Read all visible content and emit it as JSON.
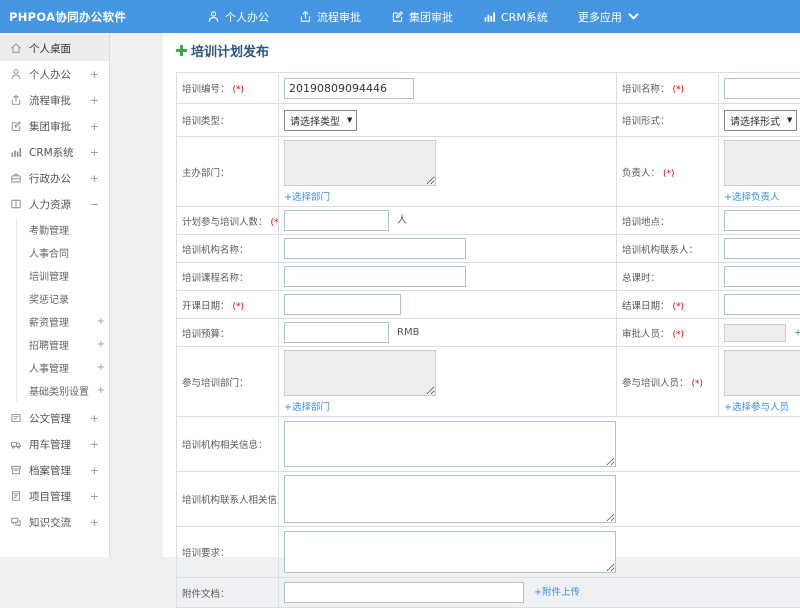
{
  "colors": {
    "topbar": "#4496e2",
    "link": "#3a8ee6",
    "required": "#e60000",
    "title": "#2a5580",
    "plus_green": "#3fa945",
    "sidebar_active": "#ececec"
  },
  "topbar": {
    "logo": "PHPOA协同办公软件",
    "menu_icon": "menu-icon",
    "nav": [
      {
        "id": "personal-office",
        "icon": "user-icon",
        "label": "个人办公"
      },
      {
        "id": "workflow-approval",
        "icon": "flow-icon",
        "label": "流程审批"
      },
      {
        "id": "group-approval",
        "icon": "edit-icon",
        "label": "集团审批"
      },
      {
        "id": "crm",
        "icon": "chart-icon",
        "label": "CRM系统"
      },
      {
        "id": "more-apps",
        "icon": "caret-down-icon",
        "label": "更多应用",
        "caret": true
      }
    ]
  },
  "sidebar": {
    "items": [
      {
        "id": "desktop",
        "icon": "home-icon",
        "label": "个人桌面",
        "active": true
      },
      {
        "id": "personal-office",
        "icon": "user-icon",
        "label": "个人办公",
        "expand": "+"
      },
      {
        "id": "workflow-approval",
        "icon": "flow-icon",
        "label": "流程审批",
        "expand": "+"
      },
      {
        "id": "group-approval",
        "icon": "edit-icon",
        "label": "集团审批",
        "expand": "+"
      },
      {
        "id": "crm",
        "icon": "chart-icon",
        "label": "CRM系统",
        "expand": "+"
      },
      {
        "id": "admin-office",
        "icon": "briefcase-icon",
        "label": "行政办公",
        "expand": "+"
      },
      {
        "id": "hr",
        "icon": "hr-icon",
        "label": "人力资源",
        "expand": "−",
        "children": [
          {
            "id": "attendance",
            "label": "考勤管理"
          },
          {
            "id": "hr-contract",
            "label": "人事合同"
          },
          {
            "id": "training-mgmt",
            "label": "培训管理"
          },
          {
            "id": "rewards",
            "label": "奖惩记录"
          },
          {
            "id": "salary",
            "label": "薪资管理",
            "expand": "+"
          },
          {
            "id": "recruit",
            "label": "招聘管理",
            "expand": "+"
          },
          {
            "id": "personnel",
            "label": "人事管理",
            "expand": "+"
          },
          {
            "id": "base-category",
            "label": "基础类别设置",
            "expand": "+"
          }
        ]
      },
      {
        "id": "official-doc",
        "icon": "doc-icon",
        "label": "公文管理",
        "expand": "+"
      },
      {
        "id": "vehicle",
        "icon": "car-icon",
        "label": "用车管理",
        "expand": "+"
      },
      {
        "id": "archive",
        "icon": "archive-icon",
        "label": "档案管理",
        "expand": "+"
      },
      {
        "id": "project",
        "icon": "project-icon",
        "label": "项目管理",
        "expand": "+"
      },
      {
        "id": "knowledge",
        "icon": "chat-icon",
        "label": "知识交流",
        "expand": "+"
      }
    ]
  },
  "main": {
    "title": "培训计划发布",
    "title_icon": "plus-icon",
    "form": {
      "rows": [
        {
          "cells": [
            {
              "id": "training-no",
              "label": "培训编号：",
              "required": true,
              "field": {
                "type": "text",
                "value": "20190809094446"
              }
            },
            {
              "id": "training-name",
              "label": "培训名称：",
              "required": true,
              "field": {
                "type": "text",
                "value": ""
              }
            }
          ]
        },
        {
          "cells": [
            {
              "id": "training-type",
              "label": "培训类型：",
              "field": {
                "type": "select",
                "value": "请选择类型"
              }
            },
            {
              "id": "training-form",
              "label": "培训形式：",
              "field": {
                "type": "select",
                "value": "请选择形式"
              }
            }
          ]
        },
        {
          "cells": [
            {
              "id": "host-dept",
              "label": "主办部门：",
              "field": {
                "type": "picker",
                "link": "+选择部门"
              }
            },
            {
              "id": "leader",
              "label": "负责人：",
              "required": true,
              "field": {
                "type": "picker",
                "link": "+选择负责人"
              }
            }
          ]
        },
        {
          "cells": [
            {
              "id": "planned-participants",
              "label": "计划参与培训人数：",
              "required": true,
              "field": {
                "type": "text",
                "value": "",
                "suffix": "人"
              }
            },
            {
              "id": "training-place",
              "label": "培训地点：",
              "field": {
                "type": "text",
                "value": ""
              }
            }
          ]
        },
        {
          "cells": [
            {
              "id": "org-name",
              "label": "培训机构名称：",
              "field": {
                "type": "text",
                "value": ""
              }
            },
            {
              "id": "org-contact",
              "label": "培训机构联系人：",
              "field": {
                "type": "text",
                "value": ""
              }
            }
          ]
        },
        {
          "cells": [
            {
              "id": "course-name",
              "label": "培训课程名称：",
              "field": {
                "type": "text",
                "value": ""
              }
            },
            {
              "id": "total-hours",
              "label": "总课时：",
              "field": {
                "type": "text",
                "value": ""
              }
            }
          ]
        },
        {
          "cells": [
            {
              "id": "start-date",
              "label": "开课日期：",
              "required": true,
              "field": {
                "type": "text",
                "value": ""
              }
            },
            {
              "id": "end-date",
              "label": "结课日期：",
              "required": true,
              "field": {
                "type": "text",
                "value": ""
              }
            }
          ]
        },
        {
          "cells": [
            {
              "id": "budget",
              "label": "培训预算：",
              "field": {
                "type": "text",
                "value": "",
                "suffix": "RMB"
              }
            },
            {
              "id": "approvers",
              "label": "审批人员：",
              "required": true,
              "field": {
                "type": "picker-inline",
                "link": "+选择审批人员"
              }
            }
          ]
        },
        {
          "cells": [
            {
              "id": "participating-depts",
              "label": "参与培训部门：",
              "field": {
                "type": "picker",
                "link": "+选择部门"
              }
            },
            {
              "id": "participants",
              "label": "参与培训人员：",
              "required": true,
              "field": {
                "type": "picker",
                "link": "+选择参与人员"
              }
            }
          ]
        },
        {
          "span": true,
          "cells": [
            {
              "id": "org-info",
              "label": "培训机构相关信息：",
              "field": {
                "type": "textarea",
                "value": ""
              }
            }
          ]
        },
        {
          "span": true,
          "cells": [
            {
              "id": "org-contact-info",
              "label": "培训机构联系人相关信息：",
              "field": {
                "type": "textarea",
                "value": ""
              }
            }
          ]
        },
        {
          "span": true,
          "cells": [
            {
              "id": "training-requirements",
              "label": "培训要求：",
              "field": {
                "type": "textarea",
                "value": ""
              }
            }
          ]
        },
        {
          "span": true,
          "cells": [
            {
              "id": "attachment",
              "label": "附件文档：",
              "field": {
                "type": "text",
                "value": "",
                "link": "+附件上传"
              }
            }
          ]
        }
      ]
    }
  }
}
